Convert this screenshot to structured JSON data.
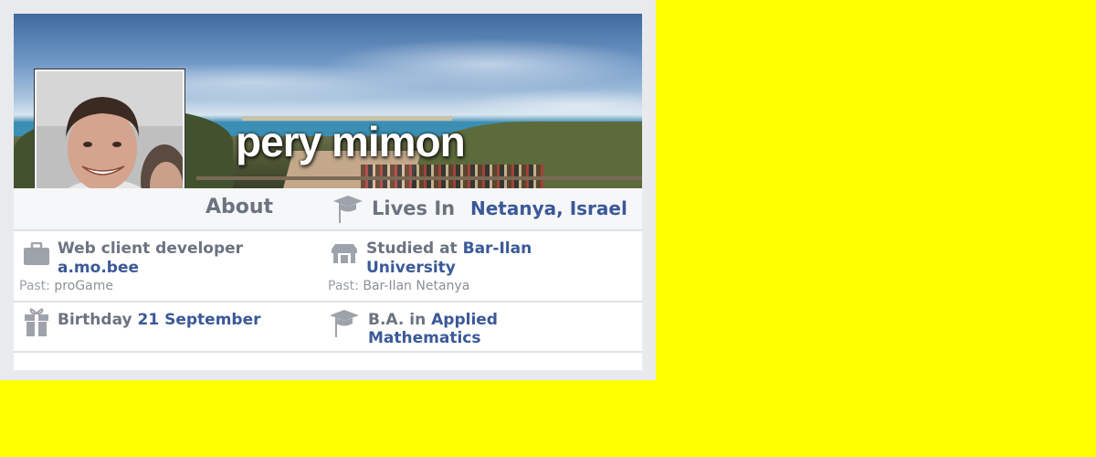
{
  "profile": {
    "name": "pery mimon"
  },
  "about": {
    "label": "About",
    "lives_in_label": "Lives In",
    "lives_in_value": "Netanya, Israel"
  },
  "work": {
    "title": "Web client developer",
    "company": "a.mo.bee",
    "past_label": "Past:",
    "past_value": "proGame"
  },
  "education": {
    "studied_label": "Studied at",
    "school_line1": "Bar-Ilan",
    "school_line2": "University",
    "past_label": "Past:",
    "past_value": "Bar-Ilan Netanya"
  },
  "birthday": {
    "label": "Birthday",
    "value": "21 September"
  },
  "degree": {
    "prefix": "B.A. in",
    "value_line1": "Applied",
    "value_line2": "Mathematics"
  },
  "icons": [
    "briefcase-icon",
    "school-icon",
    "gift-icon",
    "graduation-cap-icon",
    "home-cap-icon"
  ],
  "colors": {
    "link": "#3b5998",
    "label": "#6c7380",
    "muted": "#9a9fa8",
    "page_bg": "#ffff00"
  }
}
